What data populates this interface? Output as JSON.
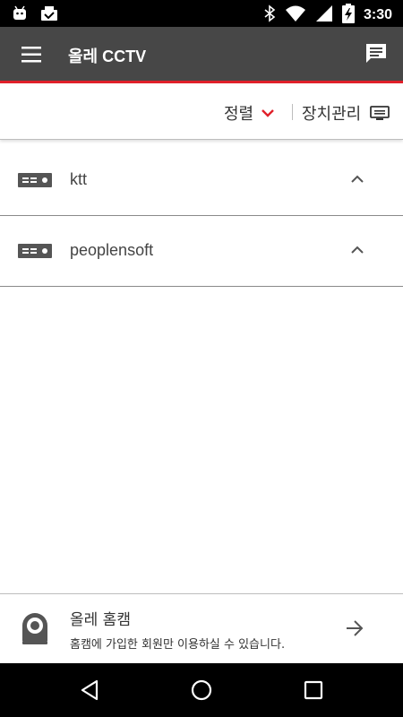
{
  "status_bar": {
    "time": "3:30",
    "battery_level": 0.8
  },
  "app_bar": {
    "title": "올레 CCTV"
  },
  "toolbar": {
    "sort_label": "정렬",
    "device_manage_label": "장치관리"
  },
  "devices": [
    {
      "name": "ktt"
    },
    {
      "name": "peoplensoft"
    }
  ],
  "promo": {
    "title": "올레 홈캠",
    "subtitle": "홈캠에 가입한 회원만 이용하실 수 있습니다."
  },
  "colors": {
    "app_bar": "#474747",
    "accent_red": "#e0202a",
    "status_bar": "#000000"
  }
}
